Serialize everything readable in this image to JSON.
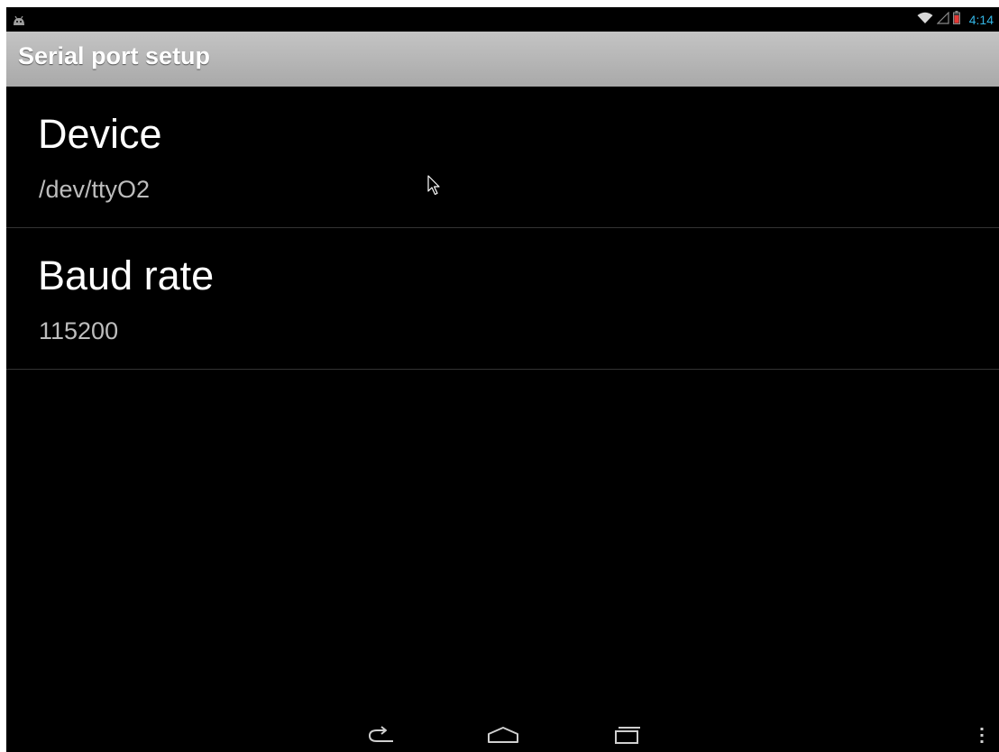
{
  "status_bar": {
    "clock": "4:14",
    "icons": [
      "android-debug-icon",
      "wifi-icon",
      "signal-icon",
      "battery-low-icon"
    ],
    "clock_color": "#33b5e5",
    "battery_color": "#e53935"
  },
  "action_bar": {
    "title": "Serial port setup"
  },
  "preferences": [
    {
      "title": "Device",
      "summary": "/dev/ttyO2"
    },
    {
      "title": "Baud rate",
      "summary": "115200"
    }
  ],
  "nav_bar": {
    "buttons": [
      "back-icon",
      "home-icon",
      "recent-apps-icon",
      "overflow-menu-icon"
    ]
  }
}
